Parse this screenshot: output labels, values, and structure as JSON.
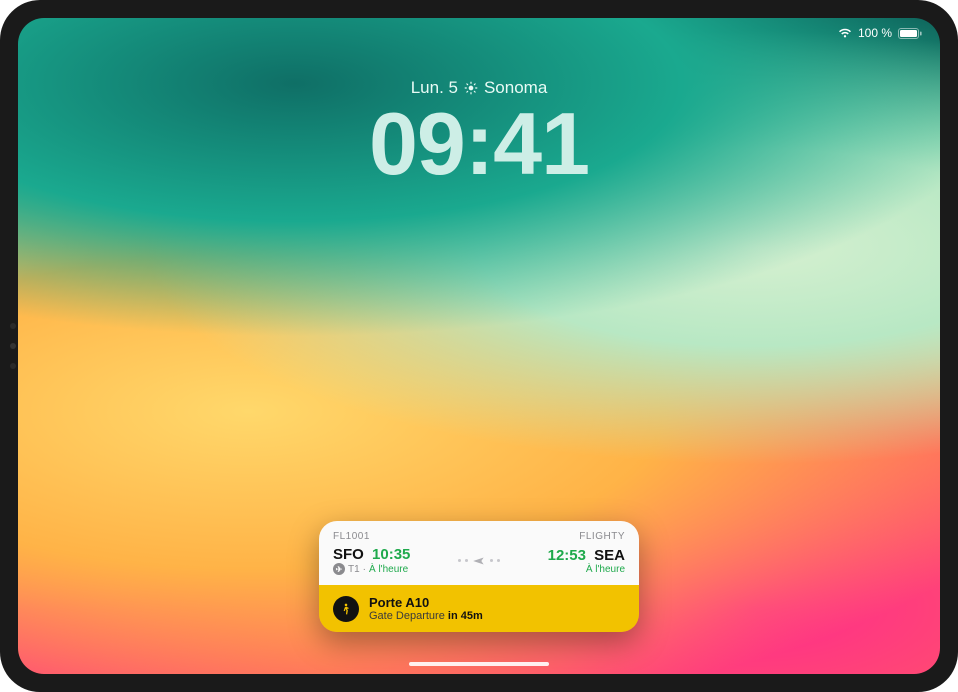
{
  "status": {
    "battery_pct": "100 %"
  },
  "lock": {
    "date_prefix": "Lun. 5",
    "location": "Sonoma",
    "time": "09:41"
  },
  "widget": {
    "flight_no": "FL1001",
    "app_name": "FLIGHTY",
    "dep": {
      "code": "SFO",
      "time": "10:35",
      "terminal_badge": "✈",
      "terminal": "T1",
      "status": "À l'heure"
    },
    "arr": {
      "code": "SEA",
      "time": "12:53",
      "status": "À l'heure"
    },
    "gate": {
      "title": "Porte A10",
      "sub_prefix": "Gate Departure",
      "sub_em": "in 45m"
    }
  }
}
